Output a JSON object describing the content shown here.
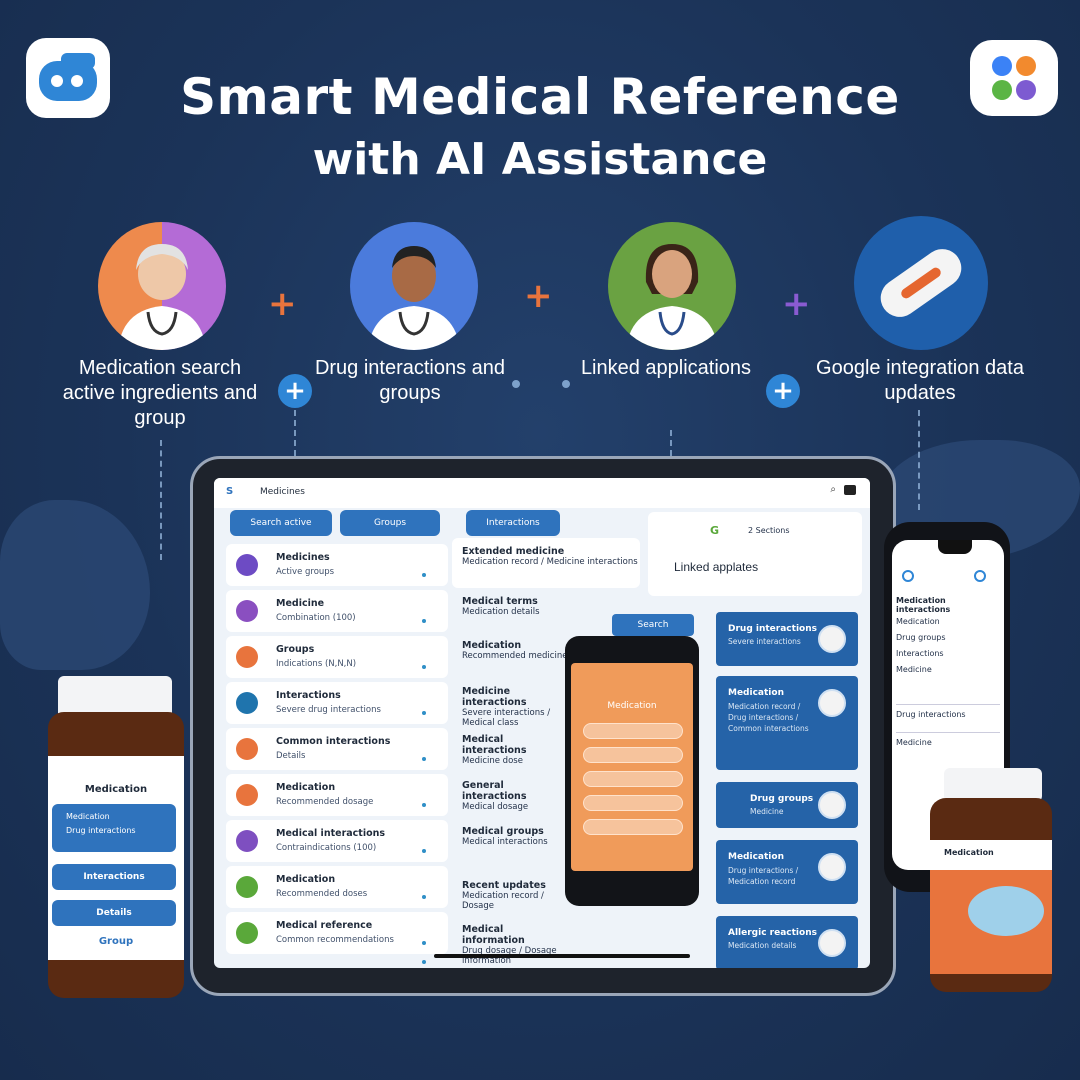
{
  "header": {
    "title_line1": "Smart Medical Reference",
    "title_line2": "with AI Assistance"
  },
  "features": [
    {
      "icon": "senior-doctor-avatar",
      "label": "Medication search active ingredients and group"
    },
    {
      "icon": "male-doctor-avatar",
      "label": "Drug interactions and groups"
    },
    {
      "icon": "female-doctor-avatar",
      "label": "Linked applications"
    },
    {
      "icon": "capsule-pill-icon",
      "label": "Google integration data updates"
    }
  ],
  "tablet": {
    "top_bar_title": "Medicines",
    "tabs": [
      "Search active",
      "Groups",
      "Interactions"
    ],
    "linked_card": {
      "badge": "2 Sections",
      "title": "Linked applates"
    },
    "list_items": [
      {
        "title": "Medicines",
        "subtitle": "Active groups",
        "color": "#6d4bc4"
      },
      {
        "title": "Medicine",
        "subtitle": "Combination (100)",
        "color": "#8a4fc0"
      },
      {
        "title": "Groups",
        "subtitle": "Indications (N,N,N)",
        "color": "#e8743d"
      },
      {
        "title": "Interactions",
        "subtitle": "Severe drug interactions",
        "color": "#1f74ad"
      },
      {
        "title": "Common interactions",
        "subtitle": "Details",
        "color": "#e8743d"
      },
      {
        "title": "Medication",
        "subtitle": "Recommended dosage",
        "color": "#e8743d"
      },
      {
        "title": "Medical interactions",
        "subtitle": "Contraindications (100)",
        "color": "#7e4fc0"
      },
      {
        "title": "Medication",
        "subtitle": "Recommended doses",
        "color": "#5aa83a"
      },
      {
        "title": "Medical reference",
        "subtitle": "Common recommendations",
        "color": "#5aa83a"
      }
    ],
    "middle_items": [
      {
        "title": "Extended medicine",
        "subtitle": "Medication record / Medicine interactions"
      },
      {
        "title": "Medical terms",
        "subtitle": "Medication details"
      },
      {
        "title": "Medication",
        "subtitle": "Recommended medicine"
      },
      {
        "title": "Medicine interactions",
        "subtitle": "Severe interactions / Medical class"
      },
      {
        "title": "Medical interactions",
        "subtitle": "Medicine dose"
      },
      {
        "title": "General interactions",
        "subtitle": "Medical dosage"
      },
      {
        "title": "Medical groups",
        "subtitle": "Medical interactions"
      },
      {
        "title": "Recent updates",
        "subtitle": "Medication record / Dosage"
      },
      {
        "title": "Medical information",
        "subtitle": "Drug dosage / Dosage information"
      }
    ],
    "search_chip": "Search",
    "right_cards": [
      {
        "title": "Drug interactions",
        "subtitle": "Severe interactions"
      },
      {
        "title": "Medication",
        "subtitle": "Medication record / Drug interactions / Common interactions"
      },
      {
        "title": "Drug groups",
        "subtitle": "Medicine"
      },
      {
        "title": "Medication",
        "subtitle": "Drug interactions / Medication record"
      },
      {
        "title": "Allergic reactions",
        "subtitle": "Medication details"
      }
    ]
  },
  "phone_mid": {
    "title": "Medication",
    "fields": [
      "",
      "",
      "",
      "",
      ""
    ]
  },
  "phone_right": {
    "title": "Medication interactions",
    "lines": [
      "Medication",
      "Drug groups",
      "Interactions",
      "Medicine",
      "Drug interactions",
      "Medicine"
    ]
  },
  "bottle_left": {
    "title": "Medication",
    "info_lines": [
      "Medication",
      "Drug interactions"
    ],
    "buttons": [
      "Interactions",
      "Details"
    ],
    "footer": "Group"
  },
  "bottle_right": {
    "title": "Medication"
  },
  "colors": {
    "background": "#1b3358",
    "accent_blue": "#2f73bd",
    "accent_orange": "#e8743d"
  }
}
